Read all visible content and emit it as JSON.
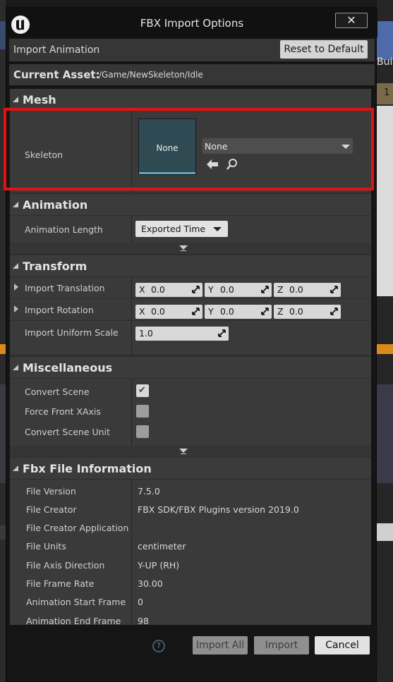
{
  "window": {
    "title": "FBX Import Options",
    "close_glyph": "✕"
  },
  "background": {
    "right_label_fragment": "Buil",
    "right_tab_fragment": "1"
  },
  "header": {
    "import_mode": "Import Animation",
    "reset_label": "Reset to Default"
  },
  "asset": {
    "label": "Current Asset:",
    "path": "/Game/NewSkeleton/Idle"
  },
  "mesh": {
    "category": "Mesh",
    "skeleton_label": "Skeleton",
    "thumbnail_text": "None",
    "combo_value": "None"
  },
  "animation": {
    "category": "Animation",
    "length_label": "Animation Length",
    "length_value": "Exported Time"
  },
  "transform": {
    "category": "Transform",
    "rows": [
      {
        "label": "Import Translation",
        "x": "0.0",
        "y": "0.0",
        "z": "0.0"
      },
      {
        "label": "Import Rotation",
        "x": "0.0",
        "y": "0.0",
        "z": "0.0"
      }
    ],
    "axis_x": "X",
    "axis_y": "Y",
    "axis_z": "Z",
    "uniform_scale_label": "Import Uniform Scale",
    "uniform_scale_value": "1.0"
  },
  "misc": {
    "category": "Miscellaneous",
    "convert_scene": {
      "label": "Convert Scene",
      "checked": true
    },
    "force_front_xaxis": {
      "label": "Force Front XAxis",
      "checked": false
    },
    "convert_scene_unit": {
      "label": "Convert Scene Unit",
      "checked": false
    },
    "check_glyph": "✔"
  },
  "fbx_info": {
    "category": "Fbx File Information",
    "rows": [
      {
        "label": "File Version",
        "value": "7.5.0"
      },
      {
        "label": "File Creator",
        "value": "FBX SDK/FBX Plugins version 2019.0"
      },
      {
        "label": "File Creator Application",
        "value": ""
      },
      {
        "label": "File Units",
        "value": "centimeter"
      },
      {
        "label": "File Axis Direction",
        "value": "Y-UP (RH)"
      },
      {
        "label": "File Frame Rate",
        "value": "30.00"
      },
      {
        "label": "Animation Start Frame",
        "value": "0"
      },
      {
        "label": "Animation End Frame",
        "value": "98"
      }
    ]
  },
  "footer": {
    "help_glyph": "?",
    "import_all_label": "Import All",
    "import_label": "Import",
    "cancel_label": "Cancel"
  },
  "colors": {
    "highlight": "#e21212",
    "thumbnail_bg": "#2f4a53",
    "thumbnail_bar": "#5fa5c2",
    "accent_orange": "#d98a1a"
  }
}
